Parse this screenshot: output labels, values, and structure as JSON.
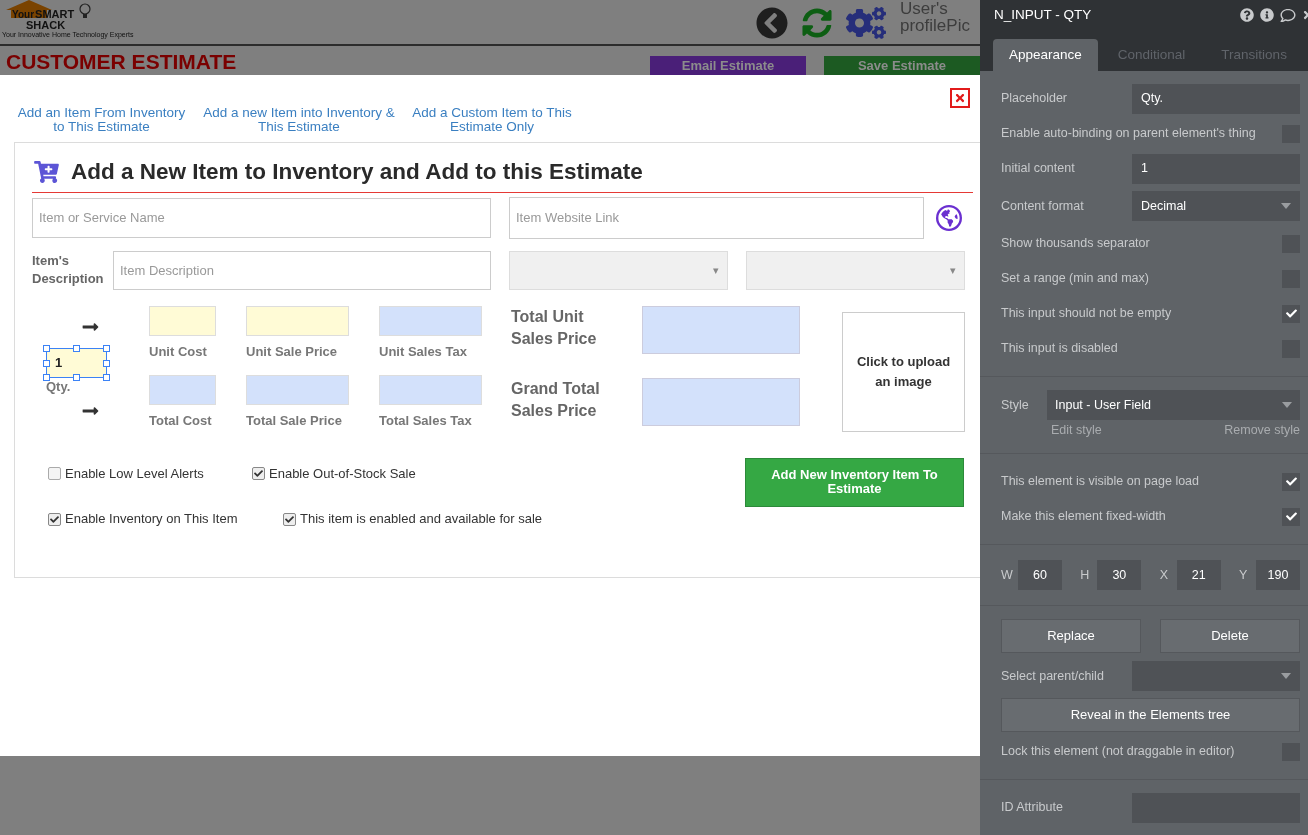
{
  "background_page": {
    "logo": {
      "word_1": "Your",
      "word_2": "SMART",
      "word_3": "SHACK",
      "tagline": "Your Innovative Home Technology Experts"
    },
    "profile_text": [
      "User's",
      "profilePic"
    ],
    "title": "CUSTOMER ESTIMATE",
    "buttons": [
      {
        "label": "Email Estimate",
        "kind": "email"
      },
      {
        "label": "Save Estimate",
        "kind": "save"
      }
    ]
  },
  "modal": {
    "links": [
      "Add an Item From Inventory to This Estimate",
      "Add a new Item into Inventory & This Estimate",
      "Add a Custom Item to This Estimate Only"
    ],
    "title": "Add a New Item to Inventory and Add to this Estimate",
    "name_field": {
      "placeholder": "Item or Service Name"
    },
    "website_field": {
      "placeholder": "Item Website Link"
    },
    "description_label": "Item's Description",
    "description_field": {
      "placeholder": "Item Description"
    },
    "dropdowns": [
      {
        "caret": "▾"
      },
      {
        "caret": "▾"
      }
    ],
    "qty": {
      "value": "1",
      "label": "Qty.",
      "selected": true
    },
    "price_fields": [
      {
        "label": "Unit Cost",
        "color": "#fffbd6"
      },
      {
        "label": "Unit Sale Price",
        "color": "#fffbd6"
      },
      {
        "label": "Unit Sales Tax",
        "color": "#d3e1fb"
      },
      {
        "label": "Total Cost",
        "color": "#d3e1fb"
      },
      {
        "label": "Total Sale Price",
        "color": "#d3e1fb"
      },
      {
        "label": "Total Sales Tax",
        "color": "#d3e1fb"
      }
    ],
    "totals": [
      {
        "label": "Total Unit Sales Price"
      },
      {
        "label": "Grand Total Sales Price"
      }
    ],
    "upload": "Click to upload an image",
    "checkboxes": [
      {
        "label": "Enable Low Level Alerts",
        "checked": false
      },
      {
        "label": "Enable Out-of-Stock Sale",
        "checked": true
      },
      {
        "label": "Enable Inventory on This Item",
        "checked": true
      },
      {
        "label": "This item is enabled and available for sale",
        "checked": true
      }
    ],
    "submit_button": "Add New Inventory Item To Estimate"
  },
  "panel": {
    "title": "N_INPUT - QTY",
    "tabs": [
      {
        "label": "Appearance",
        "selected": true
      },
      {
        "label": "Conditional",
        "selected": false
      },
      {
        "label": "Transitions",
        "selected": false
      }
    ],
    "sections": [
      {
        "rows": [
          {
            "kind": "field",
            "label": "Placeholder",
            "value": "Qty."
          },
          {
            "kind": "check",
            "label": "Enable auto-binding on parent element's thing",
            "checked": false
          },
          {
            "kind": "field",
            "label": "Initial content",
            "value": "1"
          },
          {
            "kind": "select",
            "label": "Content format",
            "value": "Decimal"
          },
          {
            "kind": "check",
            "label": "Show thousands separator",
            "checked": false
          },
          {
            "kind": "check",
            "label": "Set a range (min and max)",
            "checked": false
          },
          {
            "kind": "check",
            "label": "This input should not be empty",
            "checked": true
          },
          {
            "kind": "check",
            "label": "This input is disabled",
            "checked": false
          }
        ]
      },
      {
        "rows": [
          {
            "kind": "style",
            "label": "Style",
            "value": "Input - User Field",
            "edit": "Edit style",
            "remove": "Remove style"
          }
        ]
      },
      {
        "rows": [
          {
            "kind": "check",
            "label": "This element is visible on page load",
            "checked": true
          },
          {
            "kind": "check",
            "label": "Make this element fixed-width",
            "checked": true
          }
        ]
      },
      {
        "rows": [
          {
            "kind": "dims",
            "fields": [
              {
                "label": "W",
                "value": "60"
              },
              {
                "label": "H",
                "value": "30"
              },
              {
                "label": "X",
                "value": "21"
              },
              {
                "label": "Y",
                "value": "190"
              }
            ]
          }
        ]
      },
      {
        "rows": [
          {
            "kind": "button_pair",
            "buttons": [
              "Replace",
              "Delete"
            ]
          },
          {
            "kind": "select",
            "label": "Select parent/child"
          },
          {
            "kind": "wide_button",
            "label": "Reveal in the Elements tree"
          },
          {
            "kind": "check",
            "label": "Lock this element (not draggable in editor)",
            "checked": false
          }
        ]
      },
      {
        "rows": [
          {
            "kind": "field",
            "label": "ID Attribute"
          }
        ]
      }
    ]
  }
}
